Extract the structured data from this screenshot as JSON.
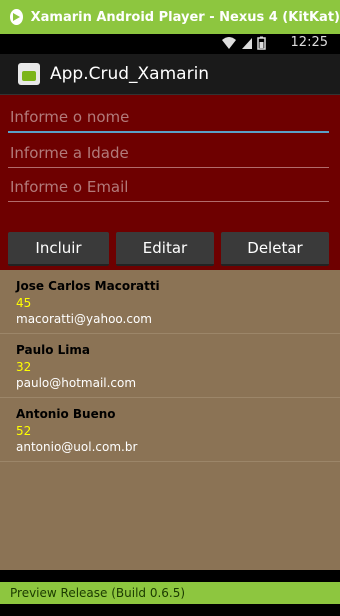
{
  "window": {
    "title": "Xamarin Android Player - Nexus 4 (KitKat)"
  },
  "statusbar": {
    "time": "12:25"
  },
  "actionbar": {
    "title": "App.Crud_Xamarin"
  },
  "form": {
    "name_placeholder": "Informe o nome",
    "age_placeholder": "Informe a Idade",
    "email_placeholder": "Informe o Email"
  },
  "buttons": {
    "include": "Incluir",
    "edit": "Editar",
    "delete": "Deletar"
  },
  "contacts": [
    {
      "name": "Jose Carlos Macoratti",
      "age": "45",
      "email": "macoratti@yahoo.com"
    },
    {
      "name": "Paulo Lima",
      "age": "32",
      "email": "paulo@hotmail.com"
    },
    {
      "name": "Antonio Bueno",
      "age": "52",
      "email": "antonio@uol.com.br"
    }
  ],
  "footer": {
    "text": "Preview Release (Build 0.6.5)"
  },
  "colors": {
    "accent": "#8dc63f",
    "form_bg": "#6e0000",
    "list_bg": "#8b7355",
    "age_color": "#ffff00"
  },
  "icons": [
    "play-icon",
    "wifi-icon",
    "signal-icon",
    "battery-icon",
    "app-icon",
    "back-icon",
    "home-icon",
    "recents-icon"
  ]
}
